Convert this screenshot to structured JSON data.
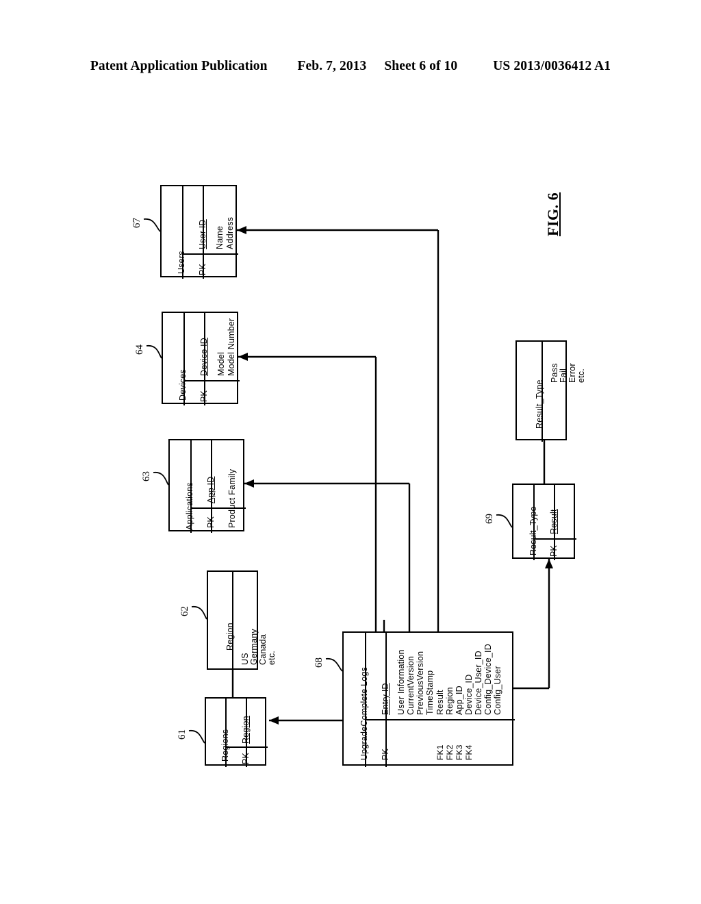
{
  "header": {
    "publication": "Patent Application Publication",
    "date": "Feb. 7, 2013",
    "sheet": "Sheet 6 of 10",
    "number": "US 2013/0036412 A1"
  },
  "figure": {
    "label": "FIG. 6",
    "entities": {
      "users": {
        "ref": "67",
        "title": "Users",
        "key_label": "PK",
        "key_field": "User ID",
        "attributes": [
          "Name",
          "Address"
        ]
      },
      "devices": {
        "ref": "64",
        "title": "Devices",
        "key_label": "PK",
        "key_field": "Device ID",
        "attributes": [
          "Model",
          "Model Number"
        ]
      },
      "applications": {
        "ref": "63",
        "title": "Applications",
        "key_label": "PK",
        "key_field": "App ID",
        "attributes": [
          "Product Family"
        ]
      },
      "region_values": {
        "ref": "62",
        "title": "Region",
        "values": [
          "US",
          "Germany",
          "Canada",
          "etc."
        ]
      },
      "regions": {
        "ref": "61",
        "title": "Regions",
        "key_label": "PK",
        "key_field": "Region",
        "attributes": []
      },
      "upgrade_logs": {
        "ref": "68",
        "title": "UpgradeComplete Logs",
        "key_label": "PK",
        "key_field": "Entry ID",
        "attributes": [
          "User Information",
          "CurrentVersion",
          "PreviousVersion",
          "TimeStamp",
          "Result",
          "Region",
          "App_ID",
          "Device_ID",
          "Device_User_ID",
          "Config_Device_ID",
          "Config_User"
        ],
        "foreign_keys": [
          "FK1",
          "FK2",
          "FK3",
          "FK4"
        ]
      },
      "result_type_table": {
        "ref": "69",
        "title": "Result_Type",
        "key_label": "PK",
        "key_field": "Result",
        "attributes": []
      },
      "result_type_values": {
        "title": "Result_Type",
        "values": [
          "Pass",
          "Fail",
          "Error",
          "etc."
        ]
      }
    }
  }
}
